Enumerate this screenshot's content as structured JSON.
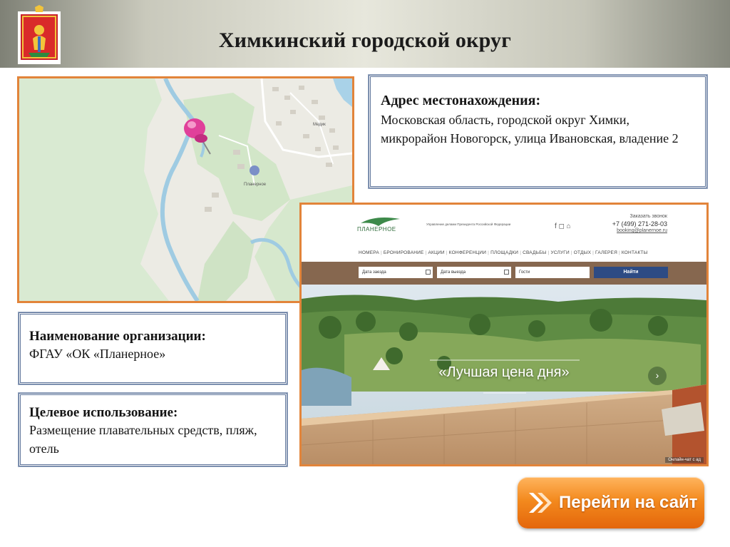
{
  "header": {
    "title": "Химкинский городской округ"
  },
  "map": {
    "labels": [
      "Планерное",
      "Медик"
    ]
  },
  "address": {
    "label": "Адрес местонахождения:",
    "value": "Московская область, городской округ Химки, микрорайон Новогорск, улица Ивановская, владение 2"
  },
  "organization": {
    "label": "Наименование организации:",
    "value": "ФГАУ «ОК «Планерное»"
  },
  "usage": {
    "label": "Целевое использование:",
    "value": "Размещение плавательных средств, пляж, отель"
  },
  "website": {
    "logo_text": "ПЛАНЕРНОЕ",
    "tagline": "Управление делами Президента Российской Федерации",
    "call_label": "Заказать звонок",
    "phone": "+7 (499) 271-28-03",
    "email": "booking@planernoe.ru",
    "nav": [
      "НОМЕРА",
      "БРОНИРОВАНИЕ",
      "АКЦИИ",
      "КОНФЕРЕНЦИИ",
      "ПЛОЩАДКИ",
      "СВАДЬБЫ",
      "УСЛУГИ",
      "ОТДЫХ",
      "ГАЛЕРЕЯ",
      "КОНТАКТЫ"
    ],
    "checkin_placeholder": "Дата заезда",
    "checkout_placeholder": "Дата выезда",
    "guests_placeholder": "Гости",
    "search_button": "Найти",
    "hero_caption": "«Лучшая цена дня»",
    "chat_label": "Онлайн-чат с ад"
  },
  "cta": {
    "label": "Перейти на сайт"
  },
  "colors": {
    "accent_orange": "#e2843a",
    "box_border": "#5c7399",
    "button_orange": "#f38a1e"
  }
}
